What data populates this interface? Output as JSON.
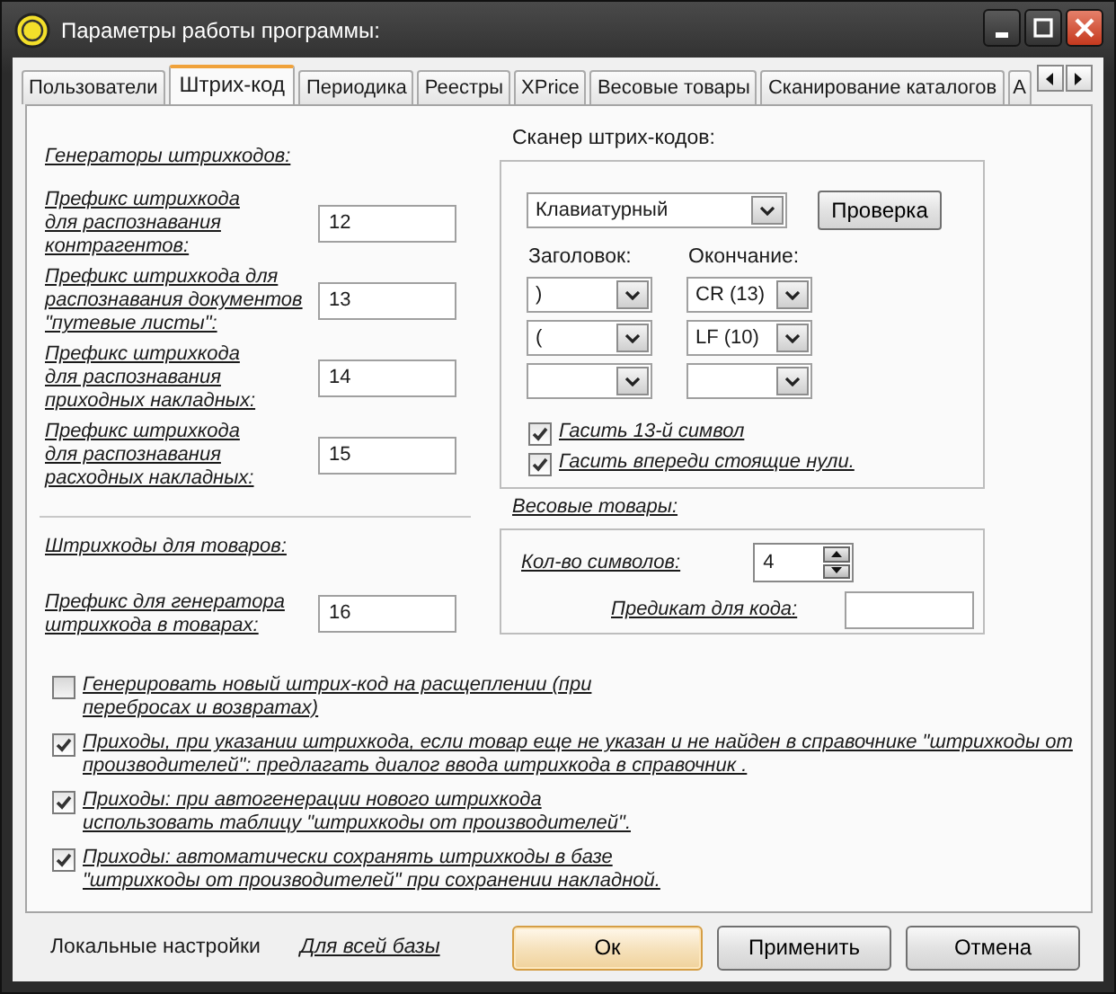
{
  "window": {
    "title": "Параметры работы программы:"
  },
  "tabs": [
    {
      "label": "Пользователи",
      "selected": false
    },
    {
      "label": "Штрих-код",
      "selected": true
    },
    {
      "label": "Периодика",
      "selected": false
    },
    {
      "label": "Реестры",
      "selected": false
    },
    {
      "label": "XPrice",
      "selected": false
    },
    {
      "label": "Весовые товары",
      "selected": false
    },
    {
      "label": "Сканирование каталогов",
      "selected": false
    },
    {
      "label": "А",
      "selected": false
    }
  ],
  "generators": {
    "heading": "Генераторы штрихкодов:",
    "fields": [
      {
        "label": "Префикс штрихкода\nдля распознавания\nконтрагентов:",
        "value": "12"
      },
      {
        "label": "Префикс штрихкода для\nраспознавания документов\n\"путевые листы\":",
        "value": "13"
      },
      {
        "label": "Префикс штрихкода\nдля распознавания\nприходных накладных:",
        "value": "14"
      },
      {
        "label": "Префикс штрихкода\nдля распознавания\nрасходных накладных:",
        "value": "15"
      }
    ]
  },
  "goods": {
    "heading": "Штрихкоды для товаров:",
    "fields": [
      {
        "label": "Префикс для генератора\nштрихкода в товарах:",
        "value": "16"
      }
    ]
  },
  "scanner": {
    "heading": "Сканер штрих-кодов:",
    "type": "Клавиатурный",
    "test_button": "Проверка",
    "header_label": "Заголовок:",
    "ending_label": "Окончание:",
    "rows": [
      {
        "header": ")",
        "ending": "CR (13)"
      },
      {
        "header": "(",
        "ending": "LF (10)"
      },
      {}
    ],
    "checks": [
      {
        "label": "Гасить 13-й символ",
        "checked": true
      },
      {
        "label": "Гасить впереди стоящие нули.",
        "checked": true
      }
    ]
  },
  "weighted": {
    "heading": "Весовые товары:",
    "count_label": "Кол-во символов:",
    "count_value": "4",
    "predicate_label": "Предикат для кода:"
  },
  "options": [
    {
      "label": "Генерировать новый штрих-код на расщеплении (при\nперебросах и возвратах)",
      "checked": false
    },
    {
      "label": "Приходы, при указании штрихкода, если товар еще не указан и не найден в справочнике \"штрихкоды от\nпроизводителей\": предлагать диалог ввода штрихкода в справочник .",
      "checked": true
    },
    {
      "label": "Приходы: при автогенерации нового штрихкода\nиспользовать таблицу \"штрихкоды от производителей\".",
      "checked": true
    },
    {
      "label": "Приходы: автоматически сохранять штрихкоды в базе\n\"штрихкоды от производителей\" при сохранении накладной.",
      "checked": true
    }
  ],
  "footer": {
    "local_label": "Локальные настройки",
    "global_link": "Для всей базы",
    "buttons": [
      {
        "label": "Ок",
        "default": true
      },
      {
        "label": "Применить",
        "default": false
      },
      {
        "label": "Отмена",
        "default": false
      }
    ]
  }
}
